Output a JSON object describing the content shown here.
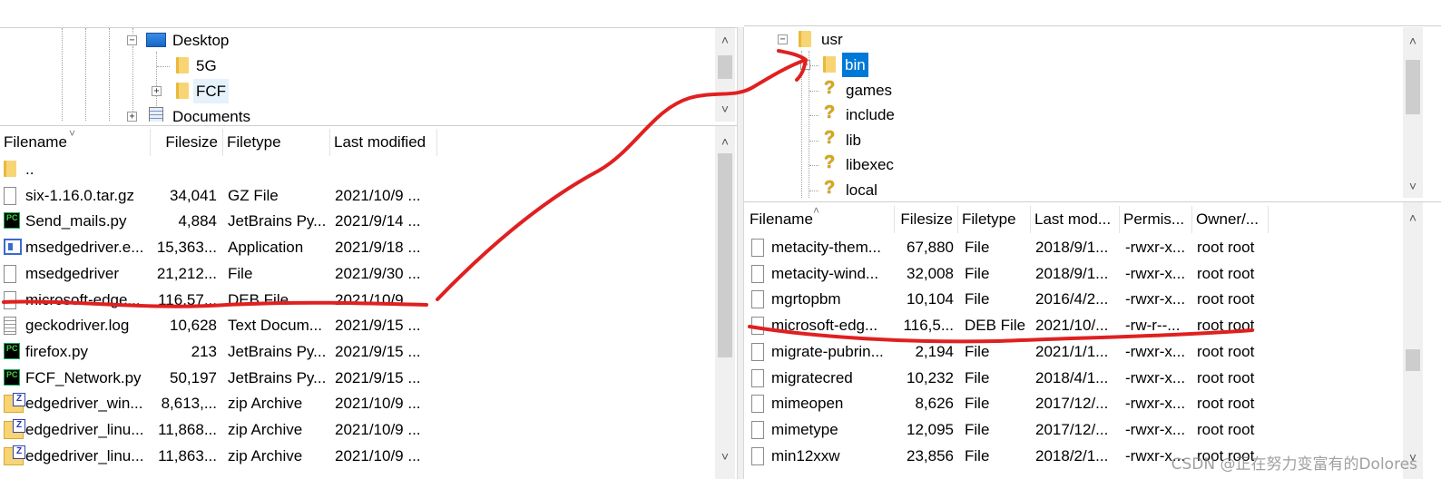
{
  "left_tree": {
    "items": [
      {
        "label": "Desktop",
        "expander": "−",
        "icon": "desktop-icon"
      },
      {
        "label": "5G",
        "expander": "",
        "icon": "folder-icon"
      },
      {
        "label": "FCF",
        "expander": "+",
        "icon": "folder-icon"
      },
      {
        "label": "Documents",
        "expander": "+",
        "icon": "documents-icon"
      }
    ]
  },
  "left_list": {
    "columns": [
      "Filename",
      "Filesize",
      "Filetype",
      "Last modified"
    ],
    "rows": [
      {
        "icon": "folder-icon",
        "name": "..",
        "size": "",
        "type": "",
        "modified": ""
      },
      {
        "icon": "file-icon",
        "name": "six-1.16.0.tar.gz",
        "size": "34,041",
        "type": "GZ File",
        "modified": "2021/10/9 ..."
      },
      {
        "icon": "pycharm-icon",
        "name": "Send_mails.py",
        "size": "4,884",
        "type": "JetBrains Py...",
        "modified": "2021/9/14 ..."
      },
      {
        "icon": "application-icon",
        "name": "msedgedriver.e...",
        "size": "15,363...",
        "type": "Application",
        "modified": "2021/9/18 ..."
      },
      {
        "icon": "file-icon",
        "name": "msedgedriver",
        "size": "21,212...",
        "type": "File",
        "modified": "2021/9/30 ..."
      },
      {
        "icon": "file-icon",
        "name": "microsoft-edge...",
        "size": "116,57...",
        "type": "DEB File",
        "modified": "2021/10/9 ..."
      },
      {
        "icon": "log-icon",
        "name": "geckodriver.log",
        "size": "10,628",
        "type": "Text Docum...",
        "modified": "2021/9/15 ..."
      },
      {
        "icon": "pycharm-icon",
        "name": "firefox.py",
        "size": "213",
        "type": "JetBrains Py...",
        "modified": "2021/9/15 ..."
      },
      {
        "icon": "pycharm-icon",
        "name": "FCF_Network.py",
        "size": "50,197",
        "type": "JetBrains Py...",
        "modified": "2021/9/15 ..."
      },
      {
        "icon": "zip-icon",
        "name": "edgedriver_win...",
        "size": "8,613,...",
        "type": "zip Archive",
        "modified": "2021/10/9 ..."
      },
      {
        "icon": "zip-icon",
        "name": "edgedriver_linu...",
        "size": "11,868...",
        "type": "zip Archive",
        "modified": "2021/10/9 ..."
      },
      {
        "icon": "zip-icon",
        "name": "edgedriver_linu...",
        "size": "11,863...",
        "type": "zip Archive",
        "modified": "2021/10/9 ..."
      }
    ]
  },
  "right_tree": {
    "items": [
      {
        "label": "usr",
        "expander": "−",
        "icon": "folder-icon",
        "selected": false
      },
      {
        "label": "bin",
        "expander": "+",
        "icon": "folder-icon",
        "selected": true
      },
      {
        "label": "games",
        "expander": "",
        "icon": "unknown-icon",
        "selected": false
      },
      {
        "label": "include",
        "expander": "",
        "icon": "unknown-icon",
        "selected": false
      },
      {
        "label": "lib",
        "expander": "",
        "icon": "unknown-icon",
        "selected": false
      },
      {
        "label": "libexec",
        "expander": "",
        "icon": "unknown-icon",
        "selected": false
      },
      {
        "label": "local",
        "expander": "",
        "icon": "unknown-icon",
        "selected": false
      }
    ]
  },
  "right_list": {
    "columns": [
      "Filename",
      "Filesize",
      "Filetype",
      "Last mod...",
      "Permis...",
      "Owner/..."
    ],
    "rows": [
      {
        "name": "metacity-them...",
        "size": "67,880",
        "type": "File",
        "modified": "2018/9/1...",
        "perm": "-rwxr-x...",
        "owner": "root root"
      },
      {
        "name": "metacity-wind...",
        "size": "32,008",
        "type": "File",
        "modified": "2018/9/1...",
        "perm": "-rwxr-x...",
        "owner": "root root"
      },
      {
        "name": "mgrtopbm",
        "size": "10,104",
        "type": "File",
        "modified": "2016/4/2...",
        "perm": "-rwxr-x...",
        "owner": "root root"
      },
      {
        "name": "microsoft-edg...",
        "size": "116,5...",
        "type": "DEB File",
        "modified": "2021/10/...",
        "perm": "-rw-r--...",
        "owner": "root root"
      },
      {
        "name": "migrate-pubrin...",
        "size": "2,194",
        "type": "File",
        "modified": "2021/1/1...",
        "perm": "-rwxr-x...",
        "owner": "root root"
      },
      {
        "name": "migratecred",
        "size": "10,232",
        "type": "File",
        "modified": "2018/4/1...",
        "perm": "-rwxr-x...",
        "owner": "root root"
      },
      {
        "name": "mimeopen",
        "size": "8,626",
        "type": "File",
        "modified": "2017/12/...",
        "perm": "-rwxr-x...",
        "owner": "root root"
      },
      {
        "name": "mimetype",
        "size": "12,095",
        "type": "File",
        "modified": "2017/12/...",
        "perm": "-rwxr-x...",
        "owner": "root root"
      },
      {
        "name": "min12xxw",
        "size": "23,856",
        "type": "File",
        "modified": "2018/2/1...",
        "perm": "-rwxr-x...",
        "owner": "root root"
      }
    ]
  },
  "annotation_color": "#e02020",
  "watermark": "CSDN @正在努力变富有的Dolores"
}
